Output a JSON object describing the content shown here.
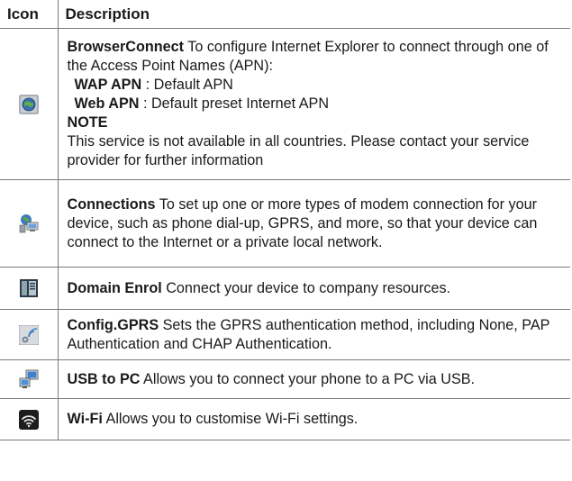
{
  "table": {
    "headers": {
      "icon": "Icon",
      "description": "Description"
    },
    "rows": [
      {
        "icon": "browser-connect-globe-icon",
        "title": "BrowserConnect",
        "text": "To configure Internet Explorer to connect through one of the Access Point Names (APN):",
        "sub_items": [
          {
            "label": "WAP APN",
            "sep": " : ",
            "text": "Default APN"
          },
          {
            "label": "Web APN",
            "sep": " : ",
            "text": "Default preset Internet APN"
          }
        ],
        "note_label": "NOTE",
        "note_text": "This service is not available in all countries. Please contact your service provider for further information"
      },
      {
        "icon": "connections-globe-computer-icon",
        "title": "Connections",
        "text": "To set up one or more types of modem connection for your device, such as phone dial-up, GPRS, and more, so that your device can connect to the Internet or a private local network."
      },
      {
        "icon": "domain-enrol-server-icon",
        "title": "Domain Enrol",
        "text": "Connect your device to company resources."
      },
      {
        "icon": "config-gprs-signal-gear-icon",
        "title": "Config.GPRS",
        "text": "Sets the GPRS authentication method, including None, PAP Authentication and CHAP Authentication."
      },
      {
        "icon": "usb-to-pc-monitors-icon",
        "title": "USB to PC",
        "text": "Allows you to connect your phone to a PC via USB."
      },
      {
        "icon": "wifi-icon",
        "title": "Wi-Fi",
        "text": "Allows you to customise Wi-Fi settings."
      }
    ]
  }
}
